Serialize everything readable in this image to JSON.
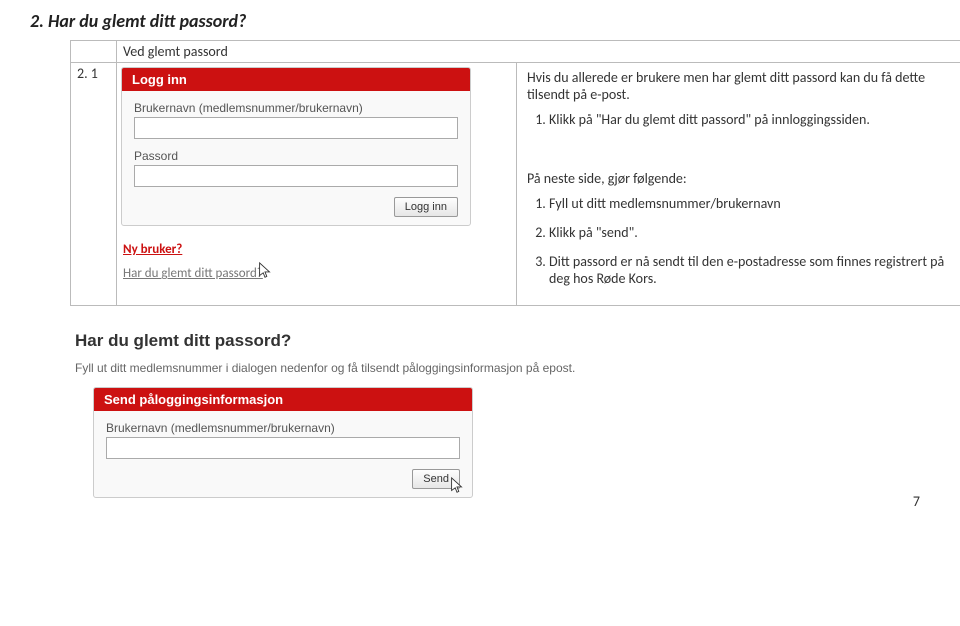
{
  "heading": "2. Har du glemt ditt passord?",
  "header_label": "Ved glemt passord",
  "step_num": "2. 1",
  "login_box": {
    "title": "Logg inn",
    "username_label": "Brukernavn (medlemsnummer/brukernavn)",
    "password_label": "Passord",
    "login_btn": "Logg inn"
  },
  "links": {
    "new_user": "Ny bruker?",
    "forgot": "Har du glemt ditt passord?"
  },
  "instructions": {
    "intro": "Hvis du allerede er brukere men har glemt ditt passord kan du få dette tilsendt på e-post.",
    "step1": "Klikk på \"Har du glemt ditt passord\" på innloggingssiden.",
    "next_intro": "På neste side, gjør følgende:",
    "n1": "Fyll ut ditt medlemsnummer/brukernavn",
    "n2": "Klikk på \"send\".",
    "n3": "Ditt passord er nå sendt til den e-postadresse som finnes registrert på deg hos Røde Kors."
  },
  "lower": {
    "title": "Har du glemt ditt passord?",
    "subtitle": "Fyll ut ditt medlemsnummer i dialogen nedenfor og få tilsendt påloggingsinformasjon på epost.",
    "box_title": "Send påloggingsinformasjon",
    "username_label": "Brukernavn (medlemsnummer/brukernavn)",
    "send_btn": "Send"
  },
  "page_number": "7"
}
